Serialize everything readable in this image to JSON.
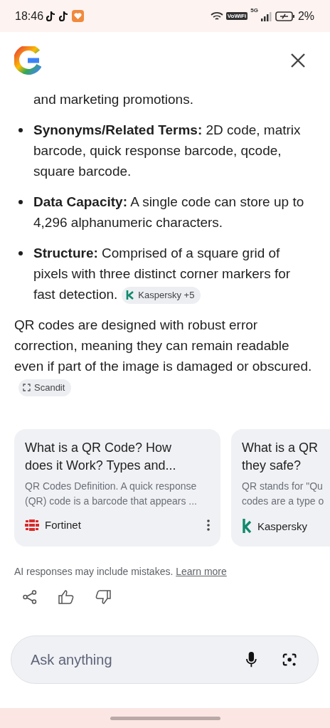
{
  "status_bar": {
    "time": "18:46",
    "vowifi": "VoWiFi",
    "network": "5G",
    "battery": "2%"
  },
  "content": {
    "lead_in": "and marketing promotions.",
    "bullets": [
      {
        "text": "**Synonyms/Related Terms:** 2D code, matrix barcode, quick response barcode, qcode, square barcode."
      },
      {
        "text": "**Data Capacity:** A single code can store up to 4,296 alphanumeric characters."
      },
      {
        "text": "**Structure:** Comprised of a square grid of pixels with three distinct corner markers for fast detection.",
        "chip": {
          "kind": "kaspersky",
          "label": "Kaspersky +5"
        }
      }
    ],
    "paragraph": {
      "text": "QR codes are designed with robust error correction, meaning they can remain readable even if part of the image is damaged or obscured.",
      "chip": {
        "kind": "scandit",
        "label": "Scandit"
      }
    }
  },
  "sources": [
    {
      "title_lines": [
        "What is a QR Code? How",
        "does it Work? Types and..."
      ],
      "snippet_lines": [
        "QR Codes Definition. A quick response",
        "(QR) code is a barcode that appears ..."
      ],
      "source": "Fortinet",
      "kind": "fortinet",
      "more": true
    },
    {
      "title_lines": [
        "What is a QR",
        "they safe?"
      ],
      "snippet_lines": [
        "QR stands for \"Qu",
        "codes are a type o"
      ],
      "source": "Kaspersky",
      "kind": "kaspersky",
      "more": false
    }
  ],
  "disclaimer": {
    "text": "AI responses may include mistakes.",
    "link": "Learn more"
  },
  "search": {
    "placeholder": "Ask anything"
  }
}
